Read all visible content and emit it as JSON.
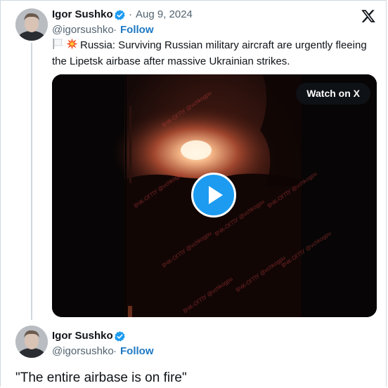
{
  "tweets": [
    {
      "author_name": "Igor Sushko",
      "handle": "@igorsushko",
      "separator": "·",
      "date": "Aug 9, 2024",
      "follow_label": "Follow",
      "flag_emoji": "🏳️",
      "boom_emoji": "💥",
      "text": "Russia: Surviving Russian military aircraft are urgently fleeing the Lipetsk airbase after massive Ukrainian strikes.",
      "video": {
        "watch_label": "Watch on X",
        "watermark": "ВЧК-ОГПУ @vchkogpu"
      }
    },
    {
      "author_name": "Igor Sushko",
      "handle": "@igorsushko",
      "separator": "·",
      "follow_label": "Follow",
      "text": "\"The entire airbase is on fire\""
    }
  ],
  "colors": {
    "accent": "#1d9bf0",
    "follow": "#1d78c3",
    "secondary_text": "#536471",
    "primary_text": "#0f1419"
  },
  "icons": {
    "verified": "verified-badge-icon",
    "x_logo": "x-logo-icon",
    "play": "play-icon"
  }
}
